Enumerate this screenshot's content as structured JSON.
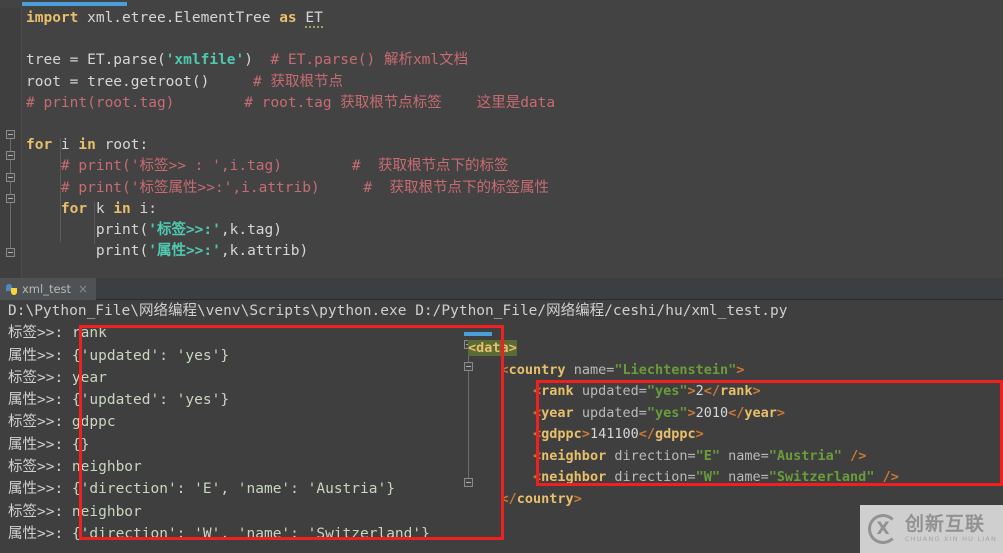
{
  "editor": {
    "lines": [
      [
        {
          "t": "import",
          "c": "kw"
        },
        {
          "t": " xml.etree.ElementTree ",
          "c": "plain"
        },
        {
          "t": "as",
          "c": "kw"
        },
        {
          "t": " ",
          "c": "plain"
        },
        {
          "t": "ET",
          "c": "err-underline plain"
        }
      ],
      [],
      [
        {
          "t": "tree = ET.parse(",
          "c": "plain"
        },
        {
          "t": "'xmlfile'",
          "c": "cstr"
        },
        {
          "t": ")  ",
          "c": "plain"
        },
        {
          "t": "# ET.parse() 解析xml文档",
          "c": "com"
        }
      ],
      [
        {
          "t": "root = tree.getroot()     ",
          "c": "plain"
        },
        {
          "t": "# 获取根节点",
          "c": "com"
        }
      ],
      [
        {
          "t": "# print(root.tag)        ",
          "c": "com"
        },
        {
          "t": "# root.tag 获取根节点标签    这里是data",
          "c": "com"
        }
      ],
      [],
      [
        {
          "t": "for",
          "c": "kw"
        },
        {
          "t": " i ",
          "c": "plain"
        },
        {
          "t": "in",
          "c": "kw"
        },
        {
          "t": " root:",
          "c": "plain"
        }
      ],
      [
        {
          "t": "    # print('标签>> : ',i.tag)        ",
          "c": "com"
        },
        {
          "t": "#  获取根节点下的标签",
          "c": "com"
        }
      ],
      [
        {
          "t": "    # print('标签属性>>:',i.attrib)     ",
          "c": "com"
        },
        {
          "t": "#  获取根节点下的标签属性",
          "c": "com"
        }
      ],
      [
        {
          "t": "    ",
          "c": "plain"
        },
        {
          "t": "for",
          "c": "kw"
        },
        {
          "t": " k ",
          "c": "plain"
        },
        {
          "t": "in",
          "c": "kw"
        },
        {
          "t": " i:",
          "c": "plain"
        }
      ],
      [
        {
          "t": "        print(",
          "c": "plain"
        },
        {
          "t": "'标签>>:'",
          "c": "cstr"
        },
        {
          "t": ",k.tag)",
          "c": "plain"
        }
      ],
      [
        {
          "t": "        print(",
          "c": "plain"
        },
        {
          "t": "'属性>>:'",
          "c": "cstr"
        },
        {
          "t": ",k.attrib)",
          "c": "plain"
        }
      ]
    ]
  },
  "console": {
    "tab": {
      "label": "xml_test",
      "icon": "python-icon",
      "close": "×"
    },
    "command": "D:\\Python_File\\网络编程\\venv\\Scripts\\python.exe D:/Python_File/网络编程/ceshi/hu/xml_test.py",
    "rows": [
      {
        "label": "标签>>:",
        "value": "rank"
      },
      {
        "label": "属性>>:",
        "value": "{'updated': 'yes'}"
      },
      {
        "label": "标签>>:",
        "value": "year"
      },
      {
        "label": "属性>>:",
        "value": "{'updated': 'yes'}"
      },
      {
        "label": "标签>>:",
        "value": "gdppc"
      },
      {
        "label": "属性>>:",
        "value": "{}"
      },
      {
        "label": "标签>>:",
        "value": "neighbor"
      },
      {
        "label": "属性>>:",
        "value": "{'direction': 'E', 'name': 'Austria'}"
      },
      {
        "label": "标签>>:",
        "value": "neighbor"
      },
      {
        "label": "属性>>:",
        "value": "{'direction': 'W', 'name': 'Switzerland'}"
      }
    ]
  },
  "xml_panel": {
    "lines": [
      [
        {
          "t": "<data>",
          "c": "sel"
        }
      ],
      [
        {
          "t": "    ",
          "c": "txtv"
        },
        {
          "t": "<",
          "c": "brk"
        },
        {
          "t": "country",
          "c": "tagb"
        },
        {
          "t": " name=",
          "c": "attr"
        },
        {
          "t": "\"Liechtenstein\"",
          "c": "aval"
        },
        {
          "t": ">",
          "c": "brk"
        }
      ],
      [
        {
          "t": "        ",
          "c": "txtv"
        },
        {
          "t": "<",
          "c": "brk"
        },
        {
          "t": "rank",
          "c": "tagb"
        },
        {
          "t": " updated=",
          "c": "attr"
        },
        {
          "t": "\"yes\"",
          "c": "aval"
        },
        {
          "t": ">",
          "c": "brk"
        },
        {
          "t": "2",
          "c": "txtv"
        },
        {
          "t": "</",
          "c": "brk"
        },
        {
          "t": "rank",
          "c": "tagb"
        },
        {
          "t": ">",
          "c": "brk"
        }
      ],
      [
        {
          "t": "        ",
          "c": "txtv"
        },
        {
          "t": "<",
          "c": "brk"
        },
        {
          "t": "year",
          "c": "tagb"
        },
        {
          "t": " updated=",
          "c": "attr"
        },
        {
          "t": "\"yes\"",
          "c": "aval"
        },
        {
          "t": ">",
          "c": "brk"
        },
        {
          "t": "2010",
          "c": "txtv"
        },
        {
          "t": "</",
          "c": "brk"
        },
        {
          "t": "year",
          "c": "tagb"
        },
        {
          "t": ">",
          "c": "brk"
        }
      ],
      [
        {
          "t": "        ",
          "c": "txtv"
        },
        {
          "t": "<",
          "c": "brk"
        },
        {
          "t": "gdppc",
          "c": "tagb"
        },
        {
          "t": ">",
          "c": "brk"
        },
        {
          "t": "141100",
          "c": "txtv"
        },
        {
          "t": "</",
          "c": "brk"
        },
        {
          "t": "gdppc",
          "c": "tagb"
        },
        {
          "t": ">",
          "c": "brk"
        }
      ],
      [
        {
          "t": "        ",
          "c": "txtv"
        },
        {
          "t": "<",
          "c": "brk"
        },
        {
          "t": "neighbor",
          "c": "tagb"
        },
        {
          "t": " direction=",
          "c": "attr"
        },
        {
          "t": "\"E\"",
          "c": "aval"
        },
        {
          "t": " name=",
          "c": "attr"
        },
        {
          "t": "\"Austria\"",
          "c": "aval"
        },
        {
          "t": " ",
          "c": "attr"
        },
        {
          "t": "/>",
          "c": "brk"
        }
      ],
      [
        {
          "t": "        ",
          "c": "txtv"
        },
        {
          "t": "<",
          "c": "brk"
        },
        {
          "t": "neighbor",
          "c": "tagb"
        },
        {
          "t": " direction=",
          "c": "attr"
        },
        {
          "t": "\"W\"",
          "c": "aval"
        },
        {
          "t": " name=",
          "c": "attr"
        },
        {
          "t": "\"Switzerland\"",
          "c": "aval"
        },
        {
          "t": " ",
          "c": "attr"
        },
        {
          "t": "/>",
          "c": "brk"
        }
      ],
      [
        {
          "t": "    ",
          "c": "txtv"
        },
        {
          "t": "</",
          "c": "brk"
        },
        {
          "t": "country",
          "c": "tagb"
        },
        {
          "t": ">",
          "c": "brk"
        }
      ]
    ]
  },
  "watermark": {
    "cn": "创新互联",
    "en": "CHUANG XIN HU LIAN",
    "mark": "X"
  },
  "colors": {
    "editor_bg": "#434343",
    "console_bg": "#3f3f3f",
    "annotation_red": "#f02020",
    "accent_blue": "#4a9fd8",
    "keyword": "#e8bf6a",
    "comment": "#c76b72",
    "string": "#4ec9b0",
    "xml_attr_value": "#6a9c3a"
  }
}
